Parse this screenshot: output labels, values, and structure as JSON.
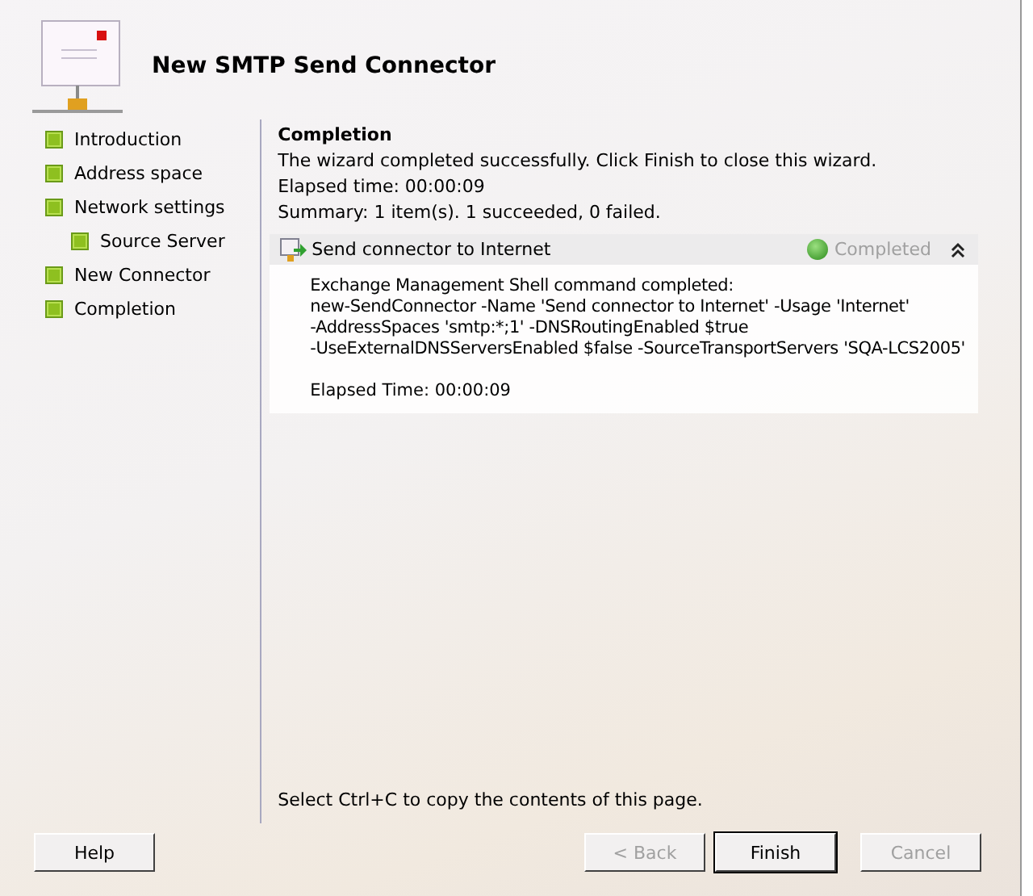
{
  "window": {
    "title": "New SMTP Send Connector"
  },
  "steps": [
    {
      "label": "Introduction"
    },
    {
      "label": "Address space"
    },
    {
      "label": "Network settings",
      "children": [
        {
          "label": "Source Server"
        }
      ]
    },
    {
      "label": "New Connector"
    },
    {
      "label": "Completion"
    }
  ],
  "page": {
    "heading": "Completion",
    "lines": [
      "The wizard completed successfully. Click Finish to close this wizard.",
      "Elapsed time: 00:00:09",
      "Summary: 1 item(s). 1 succeeded, 0 failed."
    ],
    "result": {
      "title": "Send connector to Internet",
      "status": "Completed",
      "expanded": true,
      "details": [
        "Exchange Management Shell command completed:",
        "new-SendConnector -Name 'Send connector to Internet' -Usage 'Internet'",
        "-AddressSpaces 'smtp:*;1' -DNSRoutingEnabled $true",
        "-UseExternalDNSServersEnabled $false -SourceTransportServers 'SQA-LCS2005'"
      ],
      "elapsed": "Elapsed Time: 00:00:09"
    },
    "hint": "Select Ctrl+C to copy the contents of this page."
  },
  "buttons": [
    {
      "label": "Help",
      "disabled": false,
      "default": false
    },
    {
      "label": "< Back",
      "disabled": true,
      "default": false
    },
    {
      "label": "Finish",
      "disabled": false,
      "default": true
    },
    {
      "label": "Cancel",
      "disabled": true,
      "default": false
    }
  ]
}
